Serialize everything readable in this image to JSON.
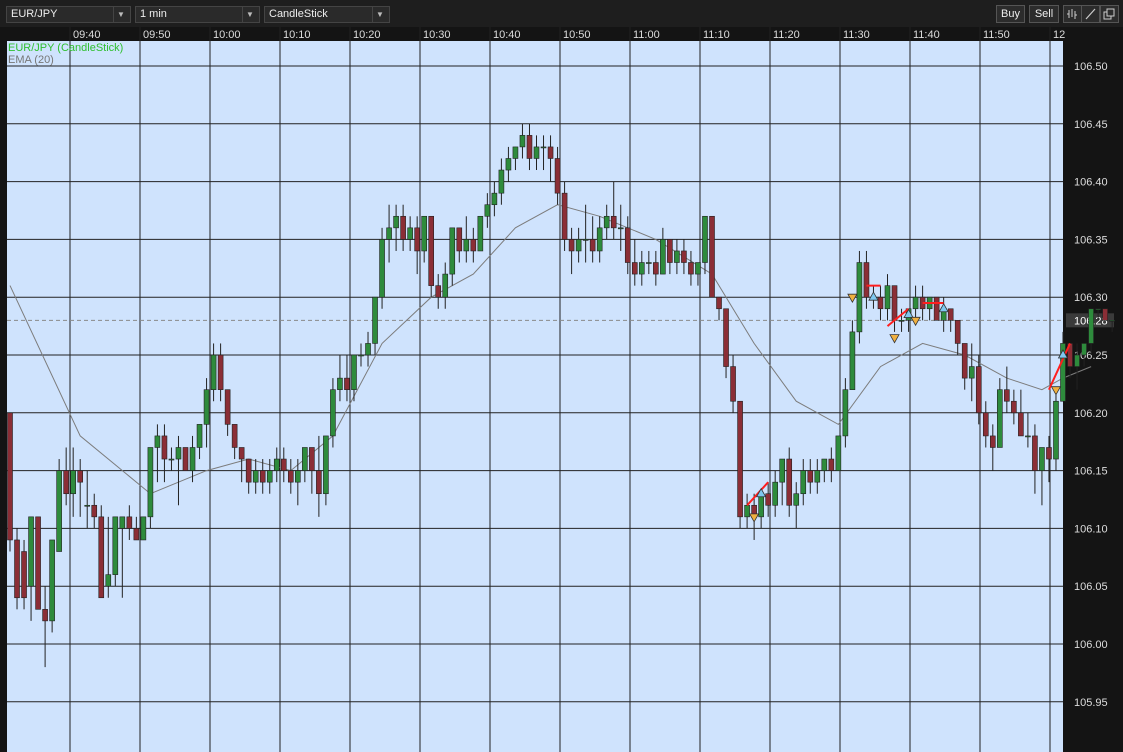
{
  "toolbar": {
    "symbol": "EUR/JPY",
    "interval": "1 min",
    "chart_style": "CandleStick",
    "buy_label": "Buy",
    "sell_label": "Sell",
    "icons": [
      "bars-icon",
      "draw-line-icon",
      "popout-icon"
    ]
  },
  "legend": {
    "series_label": "EUR/JPY (CandleStick)",
    "ema_label": "EMA (20)"
  },
  "colors": {
    "background": "#cfe3fd",
    "up": "#2e8b3c",
    "down": "#8b2e36",
    "ema": "#7c7c7c",
    "series_label": "#2fbf2f",
    "signal_line": "#ff1e1e",
    "buy_marker": "#7ec8f0",
    "sell_marker": "#f0b040"
  },
  "chart_data": {
    "type": "candlestick",
    "x_ticks": [
      "09:40",
      "09:50",
      "10:00",
      "10:10",
      "10:20",
      "10:30",
      "10:40",
      "10:50",
      "11:00",
      "11:10",
      "11:20",
      "11:30",
      "11:40",
      "11:50",
      "12"
    ],
    "y_ticks": [
      "106.50",
      "106.45",
      "106.40",
      "106.35",
      "106.30",
      "106.25",
      "106.20",
      "106.15",
      "106.10",
      "106.05",
      "106.00",
      "105.95"
    ],
    "ylim": [
      105.93,
      106.52
    ],
    "current_price": "106.28",
    "candles": [
      [
        106.2,
        106.2,
        106.08,
        106.09
      ],
      [
        106.09,
        106.1,
        106.03,
        106.04
      ],
      [
        106.08,
        106.09,
        106.03,
        106.04
      ],
      [
        106.05,
        106.11,
        106.02,
        106.11
      ],
      [
        106.11,
        106.11,
        106.04,
        106.03
      ],
      [
        106.03,
        106.05,
        105.98,
        106.02
      ],
      [
        106.02,
        106.09,
        106.01,
        106.09
      ],
      [
        106.08,
        106.16,
        106.08,
        106.15
      ],
      [
        106.15,
        106.17,
        106.12,
        106.13
      ],
      [
        106.13,
        106.17,
        106.11,
        106.15
      ],
      [
        106.15,
        106.16,
        106.11,
        106.14
      ],
      [
        106.12,
        106.15,
        106.1,
        106.12
      ],
      [
        106.12,
        106.13,
        106.1,
        106.11
      ],
      [
        106.11,
        106.12,
        106.04,
        106.04
      ],
      [
        106.05,
        106.11,
        106.04,
        106.06
      ],
      [
        106.06,
        106.11,
        106.05,
        106.11
      ],
      [
        106.1,
        106.11,
        106.04,
        106.11
      ],
      [
        106.11,
        106.12,
        106.09,
        106.1
      ],
      [
        106.1,
        106.11,
        106.09,
        106.09
      ],
      [
        106.09,
        106.11,
        106.09,
        106.11
      ],
      [
        106.11,
        106.17,
        106.1,
        106.17
      ],
      [
        106.17,
        106.19,
        106.14,
        106.18
      ],
      [
        106.18,
        106.19,
        106.14,
        106.16
      ],
      [
        106.16,
        106.17,
        106.15,
        106.16
      ],
      [
        106.16,
        106.18,
        106.12,
        106.17
      ],
      [
        106.17,
        106.17,
        106.15,
        106.15
      ],
      [
        106.15,
        106.18,
        106.14,
        106.17
      ],
      [
        106.17,
        106.19,
        106.16,
        106.19
      ],
      [
        106.19,
        106.23,
        106.17,
        106.22
      ],
      [
        106.22,
        106.26,
        106.21,
        106.25
      ],
      [
        106.25,
        106.26,
        106.21,
        106.22
      ],
      [
        106.22,
        106.22,
        106.18,
        106.19
      ],
      [
        106.19,
        106.19,
        106.16,
        106.17
      ],
      [
        106.17,
        106.17,
        106.14,
        106.16
      ],
      [
        106.16,
        106.16,
        106.13,
        106.14
      ],
      [
        106.14,
        106.16,
        106.13,
        106.15
      ],
      [
        106.15,
        106.16,
        106.13,
        106.14
      ],
      [
        106.14,
        106.16,
        106.13,
        106.15
      ],
      [
        106.15,
        106.17,
        106.14,
        106.16
      ],
      [
        106.16,
        106.17,
        106.14,
        106.15
      ],
      [
        106.15,
        106.16,
        106.13,
        106.14
      ],
      [
        106.14,
        106.16,
        106.12,
        106.15
      ],
      [
        106.15,
        106.17,
        106.14,
        106.17
      ],
      [
        106.17,
        106.17,
        106.13,
        106.15
      ],
      [
        106.15,
        106.18,
        106.11,
        106.13
      ],
      [
        106.13,
        106.18,
        106.12,
        106.18
      ],
      [
        106.18,
        106.23,
        106.17,
        106.22
      ],
      [
        106.22,
        106.25,
        106.21,
        106.23
      ],
      [
        106.23,
        106.25,
        106.21,
        106.22
      ],
      [
        106.22,
        106.25,
        106.21,
        106.25
      ],
      [
        106.25,
        106.26,
        106.24,
        106.25
      ],
      [
        106.25,
        106.27,
        106.24,
        106.26
      ],
      [
        106.26,
        106.3,
        106.25,
        106.3
      ],
      [
        106.3,
        106.36,
        106.29,
        106.35
      ],
      [
        106.35,
        106.38,
        106.33,
        106.36
      ],
      [
        106.36,
        106.38,
        106.34,
        106.37
      ],
      [
        106.37,
        106.38,
        106.34,
        106.35
      ],
      [
        106.35,
        106.37,
        106.34,
        106.36
      ],
      [
        106.36,
        106.37,
        106.32,
        106.34
      ],
      [
        106.34,
        106.37,
        106.33,
        106.37
      ],
      [
        106.37,
        106.37,
        106.3,
        106.31
      ],
      [
        106.31,
        106.32,
        106.29,
        106.3
      ],
      [
        106.3,
        106.33,
        106.29,
        106.32
      ],
      [
        106.32,
        106.36,
        106.31,
        106.36
      ],
      [
        106.36,
        106.36,
        106.33,
        106.34
      ],
      [
        106.34,
        106.37,
        106.33,
        106.35
      ],
      [
        106.35,
        106.36,
        106.33,
        106.34
      ],
      [
        106.34,
        106.37,
        106.34,
        106.37
      ],
      [
        106.37,
        106.39,
        106.36,
        106.38
      ],
      [
        106.38,
        106.4,
        106.37,
        106.39
      ],
      [
        106.39,
        106.42,
        106.38,
        106.41
      ],
      [
        106.41,
        106.43,
        106.4,
        106.42
      ],
      [
        106.42,
        106.43,
        106.41,
        106.43
      ],
      [
        106.43,
        106.45,
        106.42,
        106.44
      ],
      [
        106.44,
        106.45,
        106.41,
        106.42
      ],
      [
        106.42,
        106.44,
        106.41,
        106.43
      ],
      [
        106.43,
        106.44,
        106.41,
        106.43
      ],
      [
        106.43,
        106.44,
        106.4,
        106.42
      ],
      [
        106.42,
        106.43,
        106.38,
        106.39
      ],
      [
        106.39,
        106.4,
        106.34,
        106.35
      ],
      [
        106.35,
        106.36,
        106.32,
        106.34
      ],
      [
        106.34,
        106.36,
        106.33,
        106.35
      ],
      [
        106.35,
        106.38,
        106.33,
        106.35
      ],
      [
        106.35,
        106.37,
        106.33,
        106.34
      ],
      [
        106.34,
        106.37,
        106.33,
        106.36
      ],
      [
        106.36,
        106.38,
        106.35,
        106.37
      ],
      [
        106.37,
        106.4,
        106.35,
        106.36
      ],
      [
        106.36,
        106.38,
        106.34,
        106.36
      ],
      [
        106.36,
        106.37,
        106.32,
        106.33
      ],
      [
        106.33,
        106.35,
        106.31,
        106.32
      ],
      [
        106.32,
        106.34,
        106.31,
        106.33
      ],
      [
        106.33,
        106.34,
        106.32,
        106.33
      ],
      [
        106.33,
        106.34,
        106.31,
        106.32
      ],
      [
        106.32,
        106.36,
        106.32,
        106.35
      ],
      [
        106.35,
        106.35,
        106.32,
        106.33
      ],
      [
        106.33,
        106.35,
        106.32,
        106.34
      ],
      [
        106.34,
        106.35,
        106.32,
        106.33
      ],
      [
        106.33,
        106.34,
        106.31,
        106.32
      ],
      [
        106.32,
        106.33,
        106.31,
        106.33
      ],
      [
        106.33,
        106.37,
        106.32,
        106.37
      ],
      [
        106.37,
        106.37,
        106.3,
        106.3
      ],
      [
        106.3,
        106.3,
        106.28,
        106.29
      ],
      [
        106.29,
        106.29,
        106.23,
        106.24
      ],
      [
        106.24,
        106.25,
        106.2,
        106.21
      ],
      [
        106.21,
        106.21,
        106.1,
        106.11
      ],
      [
        106.11,
        106.13,
        106.1,
        106.12
      ],
      [
        106.12,
        106.13,
        106.09,
        106.11
      ],
      [
        106.11,
        106.13,
        106.1,
        106.13
      ],
      [
        106.13,
        106.14,
        106.11,
        106.12
      ],
      [
        106.12,
        106.15,
        106.11,
        106.14
      ],
      [
        106.14,
        106.16,
        106.12,
        106.16
      ],
      [
        106.16,
        106.17,
        106.11,
        106.12
      ],
      [
        106.12,
        106.14,
        106.1,
        106.13
      ],
      [
        106.13,
        106.16,
        106.12,
        106.15
      ],
      [
        106.15,
        106.16,
        106.13,
        106.14
      ],
      [
        106.14,
        106.16,
        106.13,
        106.15
      ],
      [
        106.15,
        106.16,
        106.14,
        106.16
      ],
      [
        106.16,
        106.17,
        106.14,
        106.15
      ],
      [
        106.15,
        106.18,
        106.15,
        106.18
      ],
      [
        106.18,
        106.23,
        106.17,
        106.22
      ],
      [
        106.22,
        106.28,
        106.22,
        106.27
      ],
      [
        106.27,
        106.34,
        106.26,
        106.33
      ],
      [
        106.33,
        106.34,
        106.29,
        106.3
      ],
      [
        106.3,
        106.31,
        106.29,
        106.3
      ],
      [
        106.3,
        106.31,
        106.28,
        106.29
      ],
      [
        106.29,
        106.32,
        106.28,
        106.31
      ],
      [
        106.31,
        106.31,
        106.27,
        106.28
      ],
      [
        106.28,
        106.29,
        106.27,
        106.28
      ],
      [
        106.28,
        106.29,
        106.27,
        106.29
      ],
      [
        106.29,
        106.31,
        106.28,
        106.3
      ],
      [
        106.3,
        106.31,
        106.28,
        106.29
      ],
      [
        106.29,
        106.3,
        106.28,
        106.3
      ],
      [
        106.3,
        106.3,
        106.28,
        106.28
      ],
      [
        106.28,
        106.3,
        106.27,
        106.29
      ],
      [
        106.29,
        106.29,
        106.27,
        106.28
      ],
      [
        106.28,
        106.28,
        106.25,
        106.26
      ],
      [
        106.26,
        106.26,
        106.22,
        106.23
      ],
      [
        106.23,
        106.26,
        106.21,
        106.24
      ],
      [
        106.24,
        106.25,
        106.19,
        106.2
      ],
      [
        106.2,
        106.21,
        106.17,
        106.18
      ],
      [
        106.18,
        106.19,
        106.15,
        106.17
      ],
      [
        106.17,
        106.23,
        106.17,
        106.22
      ],
      [
        106.22,
        106.24,
        106.2,
        106.21
      ],
      [
        106.21,
        106.22,
        106.19,
        106.2
      ],
      [
        106.2,
        106.22,
        106.18,
        106.18
      ],
      [
        106.18,
        106.2,
        106.17,
        106.18
      ],
      [
        106.18,
        106.19,
        106.13,
        106.15
      ],
      [
        106.15,
        106.17,
        106.12,
        106.17
      ],
      [
        106.17,
        106.18,
        106.14,
        106.16
      ],
      [
        106.16,
        106.22,
        106.15,
        106.21
      ],
      [
        106.21,
        106.27,
        106.21,
        106.26
      ],
      [
        106.26,
        106.26,
        106.23,
        106.24
      ],
      [
        106.24,
        106.26,
        106.22,
        106.25
      ],
      [
        106.25,
        106.26,
        106.24,
        106.26
      ],
      [
        106.26,
        106.29,
        106.25,
        106.29
      ],
      [
        106.29,
        106.29,
        106.28,
        106.29
      ],
      [
        106.29,
        106.29,
        106.28,
        106.28
      ],
      [
        106.28,
        106.28,
        106.27,
        106.28
      ]
    ],
    "ema": [
      [
        0,
        106.31
      ],
      [
        10,
        106.18
      ],
      [
        20,
        106.13
      ],
      [
        28,
        106.15
      ],
      [
        34,
        106.16
      ],
      [
        40,
        106.15
      ],
      [
        46,
        106.18
      ],
      [
        53,
        106.26
      ],
      [
        60,
        106.3
      ],
      [
        66,
        106.32
      ],
      [
        72,
        106.36
      ],
      [
        78,
        106.38
      ],
      [
        84,
        106.37
      ],
      [
        92,
        106.35
      ],
      [
        100,
        106.32
      ],
      [
        106,
        106.26
      ],
      [
        112,
        106.21
      ],
      [
        118,
        106.19
      ],
      [
        124,
        106.24
      ],
      [
        130,
        106.26
      ],
      [
        136,
        106.25
      ],
      [
        142,
        106.23
      ],
      [
        147,
        106.22
      ],
      [
        150,
        106.23
      ],
      [
        154,
        106.24
      ]
    ],
    "markers": [
      {
        "type": "sell",
        "index": 106,
        "price": 106.11
      },
      {
        "type": "buy",
        "index": 107,
        "price": 106.13
      },
      {
        "type": "sell",
        "index": 120,
        "price": 106.3
      },
      {
        "type": "buy",
        "index": 123,
        "price": 106.3
      },
      {
        "type": "sell",
        "index": 126,
        "price": 106.265
      },
      {
        "type": "buy",
        "index": 128,
        "price": 106.285
      },
      {
        "type": "sell",
        "index": 129,
        "price": 106.28
      },
      {
        "type": "buy",
        "index": 133,
        "price": 106.29
      },
      {
        "type": "sell",
        "index": 149,
        "price": 106.22
      },
      {
        "type": "buy",
        "index": 150,
        "price": 106.25
      }
    ],
    "signal_lines": [
      [
        [
          105,
          106.12
        ],
        [
          108,
          106.14
        ]
      ],
      [
        [
          122,
          106.31
        ],
        [
          124,
          106.31
        ]
      ],
      [
        [
          125,
          106.275
        ],
        [
          128,
          106.29
        ]
      ],
      [
        [
          130,
          106.295
        ],
        [
          133,
          106.295
        ]
      ],
      [
        [
          148,
          106.22
        ],
        [
          151,
          106.26
        ]
      ]
    ]
  }
}
